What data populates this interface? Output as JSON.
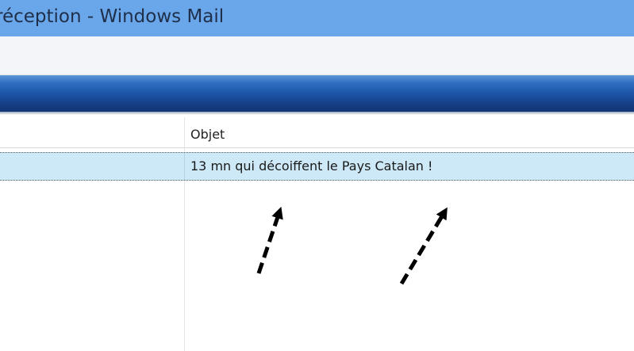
{
  "window": {
    "title": "réception - Windows Mail"
  },
  "message_list": {
    "columns": [
      "Objet"
    ],
    "rows": [
      {
        "subject": "13 mn qui décoiffent le Pays Catalan !",
        "selected": true
      }
    ]
  },
  "colors": {
    "titlebar": "#6aa7ea",
    "toolbar": "#f3f5f8",
    "bluebar": "#1d56a8",
    "selected_row": "#cde8f7"
  },
  "annotations": {
    "arrow_icon": "dashed-arrow-icon",
    "count": 2
  }
}
